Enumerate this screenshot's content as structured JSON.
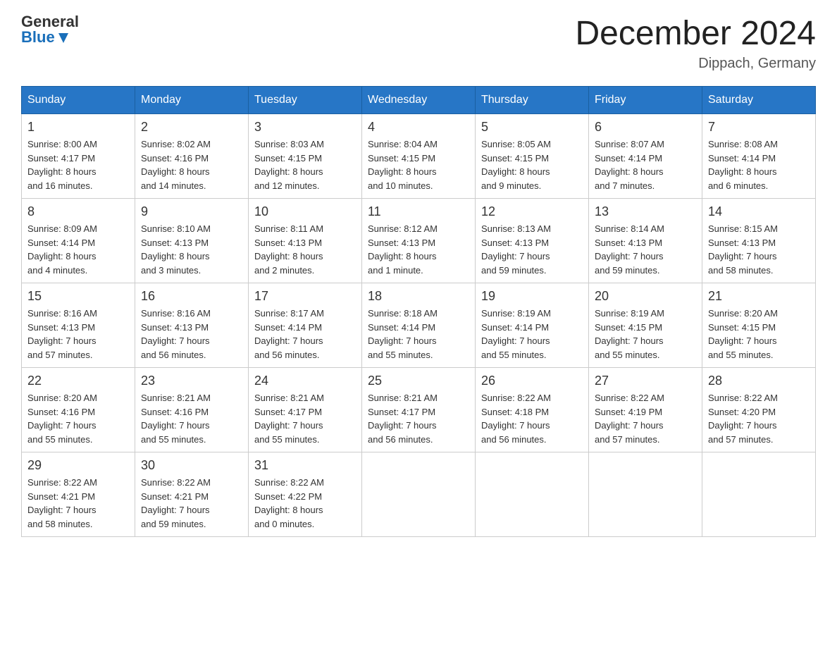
{
  "logo": {
    "general": "General",
    "blue": "Blue"
  },
  "title": "December 2024",
  "location": "Dippach, Germany",
  "headers": [
    "Sunday",
    "Monday",
    "Tuesday",
    "Wednesday",
    "Thursday",
    "Friday",
    "Saturday"
  ],
  "weeks": [
    [
      {
        "day": "1",
        "sunrise": "8:00 AM",
        "sunset": "4:17 PM",
        "daylight": "8 hours and 16 minutes."
      },
      {
        "day": "2",
        "sunrise": "8:02 AM",
        "sunset": "4:16 PM",
        "daylight": "8 hours and 14 minutes."
      },
      {
        "day": "3",
        "sunrise": "8:03 AM",
        "sunset": "4:15 PM",
        "daylight": "8 hours and 12 minutes."
      },
      {
        "day": "4",
        "sunrise": "8:04 AM",
        "sunset": "4:15 PM",
        "daylight": "8 hours and 10 minutes."
      },
      {
        "day": "5",
        "sunrise": "8:05 AM",
        "sunset": "4:15 PM",
        "daylight": "8 hours and 9 minutes."
      },
      {
        "day": "6",
        "sunrise": "8:07 AM",
        "sunset": "4:14 PM",
        "daylight": "8 hours and 7 minutes."
      },
      {
        "day": "7",
        "sunrise": "8:08 AM",
        "sunset": "4:14 PM",
        "daylight": "8 hours and 6 minutes."
      }
    ],
    [
      {
        "day": "8",
        "sunrise": "8:09 AM",
        "sunset": "4:14 PM",
        "daylight": "8 hours and 4 minutes."
      },
      {
        "day": "9",
        "sunrise": "8:10 AM",
        "sunset": "4:13 PM",
        "daylight": "8 hours and 3 minutes."
      },
      {
        "day": "10",
        "sunrise": "8:11 AM",
        "sunset": "4:13 PM",
        "daylight": "8 hours and 2 minutes."
      },
      {
        "day": "11",
        "sunrise": "8:12 AM",
        "sunset": "4:13 PM",
        "daylight": "8 hours and 1 minute."
      },
      {
        "day": "12",
        "sunrise": "8:13 AM",
        "sunset": "4:13 PM",
        "daylight": "7 hours and 59 minutes."
      },
      {
        "day": "13",
        "sunrise": "8:14 AM",
        "sunset": "4:13 PM",
        "daylight": "7 hours and 59 minutes."
      },
      {
        "day": "14",
        "sunrise": "8:15 AM",
        "sunset": "4:13 PM",
        "daylight": "7 hours and 58 minutes."
      }
    ],
    [
      {
        "day": "15",
        "sunrise": "8:16 AM",
        "sunset": "4:13 PM",
        "daylight": "7 hours and 57 minutes."
      },
      {
        "day": "16",
        "sunrise": "8:16 AM",
        "sunset": "4:13 PM",
        "daylight": "7 hours and 56 minutes."
      },
      {
        "day": "17",
        "sunrise": "8:17 AM",
        "sunset": "4:14 PM",
        "daylight": "7 hours and 56 minutes."
      },
      {
        "day": "18",
        "sunrise": "8:18 AM",
        "sunset": "4:14 PM",
        "daylight": "7 hours and 55 minutes."
      },
      {
        "day": "19",
        "sunrise": "8:19 AM",
        "sunset": "4:14 PM",
        "daylight": "7 hours and 55 minutes."
      },
      {
        "day": "20",
        "sunrise": "8:19 AM",
        "sunset": "4:15 PM",
        "daylight": "7 hours and 55 minutes."
      },
      {
        "day": "21",
        "sunrise": "8:20 AM",
        "sunset": "4:15 PM",
        "daylight": "7 hours and 55 minutes."
      }
    ],
    [
      {
        "day": "22",
        "sunrise": "8:20 AM",
        "sunset": "4:16 PM",
        "daylight": "7 hours and 55 minutes."
      },
      {
        "day": "23",
        "sunrise": "8:21 AM",
        "sunset": "4:16 PM",
        "daylight": "7 hours and 55 minutes."
      },
      {
        "day": "24",
        "sunrise": "8:21 AM",
        "sunset": "4:17 PM",
        "daylight": "7 hours and 55 minutes."
      },
      {
        "day": "25",
        "sunrise": "8:21 AM",
        "sunset": "4:17 PM",
        "daylight": "7 hours and 56 minutes."
      },
      {
        "day": "26",
        "sunrise": "8:22 AM",
        "sunset": "4:18 PM",
        "daylight": "7 hours and 56 minutes."
      },
      {
        "day": "27",
        "sunrise": "8:22 AM",
        "sunset": "4:19 PM",
        "daylight": "7 hours and 57 minutes."
      },
      {
        "day": "28",
        "sunrise": "8:22 AM",
        "sunset": "4:20 PM",
        "daylight": "7 hours and 57 minutes."
      }
    ],
    [
      {
        "day": "29",
        "sunrise": "8:22 AM",
        "sunset": "4:21 PM",
        "daylight": "7 hours and 58 minutes."
      },
      {
        "day": "30",
        "sunrise": "8:22 AM",
        "sunset": "4:21 PM",
        "daylight": "7 hours and 59 minutes."
      },
      {
        "day": "31",
        "sunrise": "8:22 AM",
        "sunset": "4:22 PM",
        "daylight": "8 hours and 0 minutes."
      },
      null,
      null,
      null,
      null
    ]
  ],
  "labels": {
    "sunrise": "Sunrise:",
    "sunset": "Sunset:",
    "daylight": "Daylight:"
  }
}
